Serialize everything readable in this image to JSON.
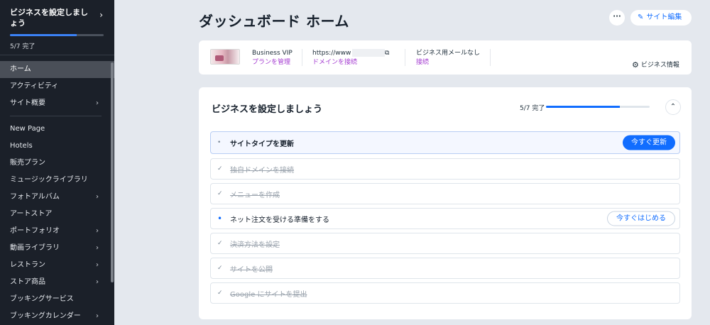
{
  "sidebar": {
    "setup": {
      "title": "ビジネスを設定しましょう",
      "chevron": "›",
      "progress_fraction": 0.714,
      "progress_label": "5/7 完了"
    },
    "group1": [
      {
        "label": "ホーム",
        "active": true,
        "chevron": false
      },
      {
        "label": "アクティビティ",
        "active": false,
        "chevron": false
      },
      {
        "label": "サイト概要",
        "active": false,
        "chevron": true
      }
    ],
    "group2": [
      {
        "label": "New Page",
        "chevron": false
      },
      {
        "label": "Hotels",
        "chevron": false
      },
      {
        "label": "販売プラン",
        "chevron": false
      },
      {
        "label": "ミュージックライブラリ",
        "chevron": false
      },
      {
        "label": "フォトアルバム",
        "chevron": true
      },
      {
        "label": "アートストア",
        "chevron": false
      },
      {
        "label": "ポートフォリオ",
        "chevron": true
      },
      {
        "label": "動画ライブラリ",
        "chevron": true
      },
      {
        "label": "レストラン",
        "chevron": true
      },
      {
        "label": "ストア商品",
        "chevron": true
      },
      {
        "label": "ブッキングサービス",
        "chevron": false
      },
      {
        "label": "ブッキングカレンダー",
        "chevron": true
      }
    ],
    "chevron_glyph": "›"
  },
  "header": {
    "title": "ダッシュボード ホーム",
    "more_label": "···",
    "edit_label": "サイト編集",
    "edit_icon": "✎"
  },
  "info": {
    "plan_title": "Business VIP",
    "plan_link": "プランを管理",
    "domain_title": "https://www",
    "domain_link": "ドメインを接続",
    "external_icon": "⧉",
    "mail_title": "ビジネス用メールなし",
    "mail_link": "接続",
    "business_info_label": "ビジネス情報",
    "business_info_icon": "⚙"
  },
  "setup_card": {
    "title": "ビジネスを設定しましょう",
    "progress_label": "5/7 完了",
    "progress_fraction": 0.714,
    "collapse_icon": "⌃",
    "tasks": [
      {
        "label": "サイトタイプを更新",
        "state": "active",
        "marker": "•",
        "cta": "今すぐ更新",
        "cta_style": "primary"
      },
      {
        "label": "独自ドメインを接続",
        "state": "done",
        "marker": "✓",
        "cta": "",
        "cta_style": ""
      },
      {
        "label": "メニューを作成",
        "state": "done",
        "marker": "✓",
        "cta": "",
        "cta_style": ""
      },
      {
        "label": "ネット注文を受ける準備をする",
        "state": "pending",
        "marker": "•",
        "cta": "今すぐはじめる",
        "cta_style": "secondary"
      },
      {
        "label": "決済方法を設定",
        "state": "done",
        "marker": "✓",
        "cta": "",
        "cta_style": ""
      },
      {
        "label": "サイトを公開",
        "state": "done",
        "marker": "✓",
        "cta": "",
        "cta_style": ""
      },
      {
        "label": "Google にサイトを提出",
        "state": "done",
        "marker": "✓",
        "cta": "",
        "cta_style": ""
      }
    ]
  },
  "colors": {
    "accent": "#116dff",
    "link_purple": "#a43bd1",
    "sidebar_bg": "#1b2029"
  }
}
